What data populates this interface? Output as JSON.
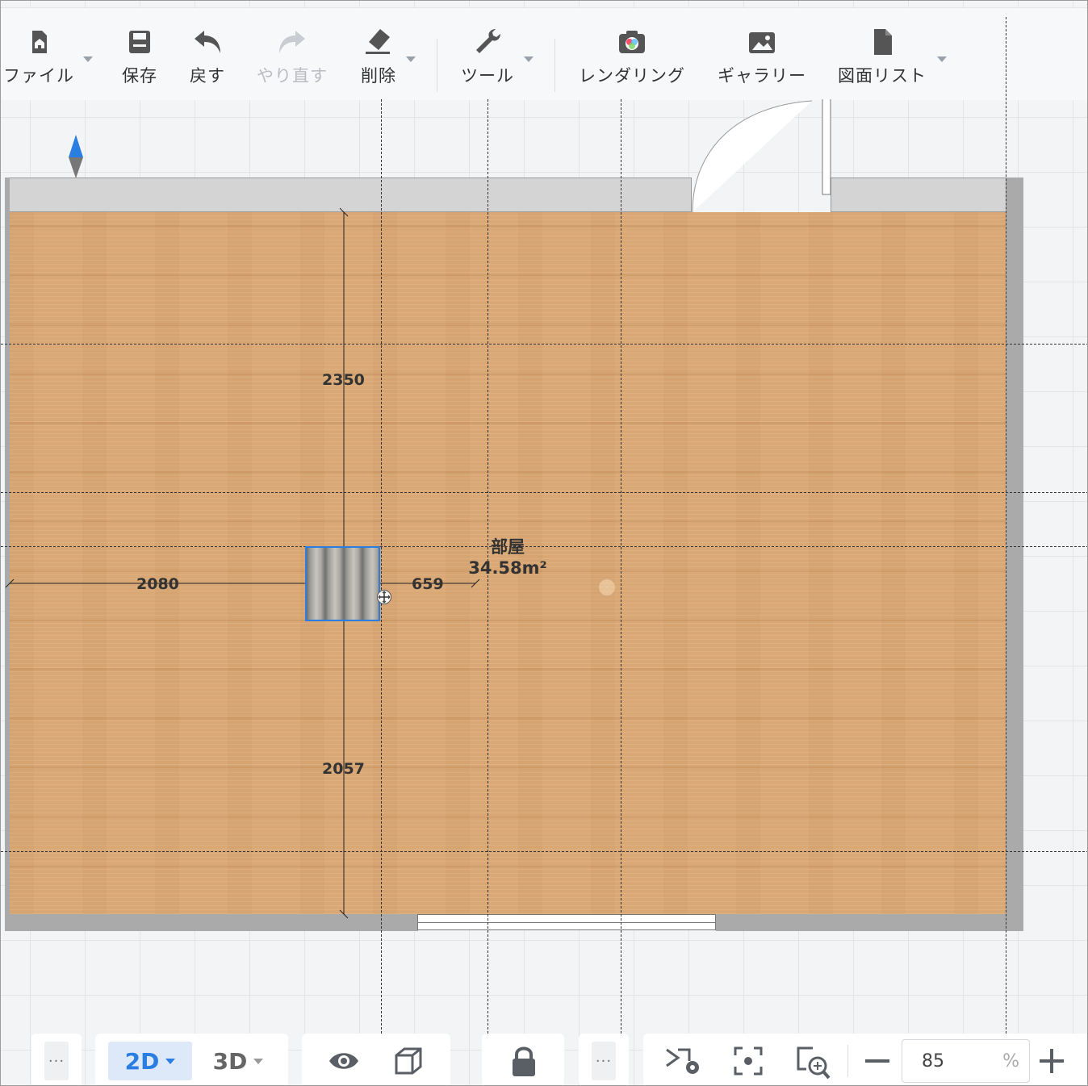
{
  "toolbar": {
    "file": "ファイル",
    "save": "保存",
    "undo": "戻す",
    "redo": "やり直す",
    "delete": "削除",
    "tools": "ツール",
    "rendering": "レンダリング",
    "gallery": "ギャラリー",
    "drawing_list": "図面リスト"
  },
  "room": {
    "name": "部屋",
    "area": "34.58m²"
  },
  "dimensions": {
    "top": "2350",
    "left": "2080",
    "right": "659",
    "bottom": "2057"
  },
  "bottombar": {
    "more1": "···",
    "view_2d": "2D",
    "view_3d": "3D",
    "more2": "···",
    "zoom_value": "85",
    "zoom_unit": "%"
  },
  "colors": {
    "accent": "#2a7de1",
    "floor": "#d9a874"
  }
}
